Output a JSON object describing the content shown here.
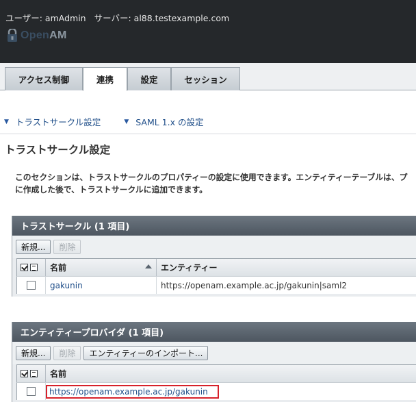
{
  "header": {
    "user_label": "ユーザー: amAdmin",
    "server_label": "サーバー: al88.testexample.com",
    "brand_open": "Open",
    "brand_am": "AM"
  },
  "tabs": [
    {
      "label": "アクセス制御",
      "active": false
    },
    {
      "label": "連携",
      "active": true
    },
    {
      "label": "設定",
      "active": false
    },
    {
      "label": "セッション",
      "active": false
    }
  ],
  "jump_links": [
    {
      "label": "トラストサークル設定"
    },
    {
      "label": "SAML 1.x の設定"
    }
  ],
  "page_title": "トラストサークル設定",
  "description": [
    "このセクションは、トラストサークルのプロパティーの設定に使用できます。エンティティーテーブルは、プ",
    "に作成した後で、トラストサークルに追加できます。"
  ],
  "cot_table": {
    "title": "トラストサークル (1 項目)",
    "buttons": {
      "new": "新規...",
      "delete": "削除"
    },
    "columns": {
      "name": "名前",
      "entity": "エンティティー"
    },
    "rows": [
      {
        "name": "gakunin",
        "entity": "https://openam.example.ac.jp/gakunin|saml2"
      }
    ]
  },
  "entity_table": {
    "title": "エンティティープロバイダ (1 項目)",
    "buttons": {
      "new": "新規...",
      "delete": "削除",
      "import": "エンティティーのインポート..."
    },
    "columns": {
      "name": "名前"
    },
    "rows": [
      {
        "name": "https://openam.example.ac.jp/gakunin"
      }
    ]
  },
  "colors": {
    "masthead": "#25282b",
    "link": "#1f4e89",
    "table_title": "#4d5660",
    "highlight": "#d7212a"
  }
}
